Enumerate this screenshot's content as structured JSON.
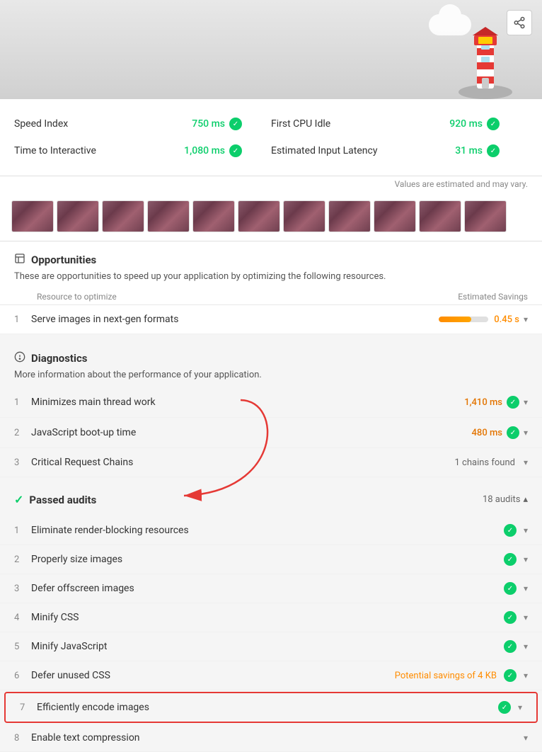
{
  "hero": {
    "share_label": "share"
  },
  "metrics": [
    {
      "label": "Speed Index",
      "value": "750 ms",
      "color": "#0cce6b"
    },
    {
      "label": "First CPU Idle",
      "value": "920 ms",
      "color": "#0cce6b"
    },
    {
      "label": "Time to Interactive",
      "value": "1,080 ms",
      "color": "#0cce6b"
    },
    {
      "label": "Estimated Input Latency",
      "value": "31 ms",
      "color": "#0cce6b"
    }
  ],
  "estimate_note": "Values are estimated and may vary.",
  "opportunities": {
    "title": "Opportunities",
    "description": "These are opportunities to speed up your application by optimizing the following resources.",
    "table_header_resource": "Resource to optimize",
    "table_header_savings": "Estimated Savings",
    "items": [
      {
        "number": "1",
        "label": "Serve images in next-gen formats",
        "savings": "0.45 s"
      }
    ]
  },
  "diagnostics": {
    "title": "Diagnostics",
    "description": "More information about the performance of your application.",
    "items": [
      {
        "number": "1",
        "label": "Minimizes main thread work",
        "value": "1,410 ms",
        "value_type": "orange",
        "has_check": true
      },
      {
        "number": "2",
        "label": "JavaScript boot-up time",
        "value": "480 ms",
        "value_type": "orange",
        "has_check": true
      },
      {
        "number": "3",
        "label": "Critical Request Chains",
        "value": "1 chains found",
        "value_type": "gray",
        "has_check": false
      }
    ]
  },
  "passed_audits": {
    "title": "Passed audits",
    "count": "18 audits",
    "items": [
      {
        "number": "1",
        "label": "Eliminate render-blocking resources",
        "extra": ""
      },
      {
        "number": "2",
        "label": "Properly size images",
        "extra": ""
      },
      {
        "number": "3",
        "label": "Defer offscreen images",
        "extra": ""
      },
      {
        "number": "4",
        "label": "Minify CSS",
        "extra": ""
      },
      {
        "number": "5",
        "label": "Minify JavaScript",
        "extra": ""
      },
      {
        "number": "6",
        "label": "Defer unused CSS",
        "extra": "Potential savings of 4 KB"
      },
      {
        "number": "7",
        "label": "Efficiently encode images",
        "extra": "",
        "highlighted": true
      },
      {
        "number": "8",
        "label": "Enable text compression",
        "extra": ""
      }
    ]
  }
}
